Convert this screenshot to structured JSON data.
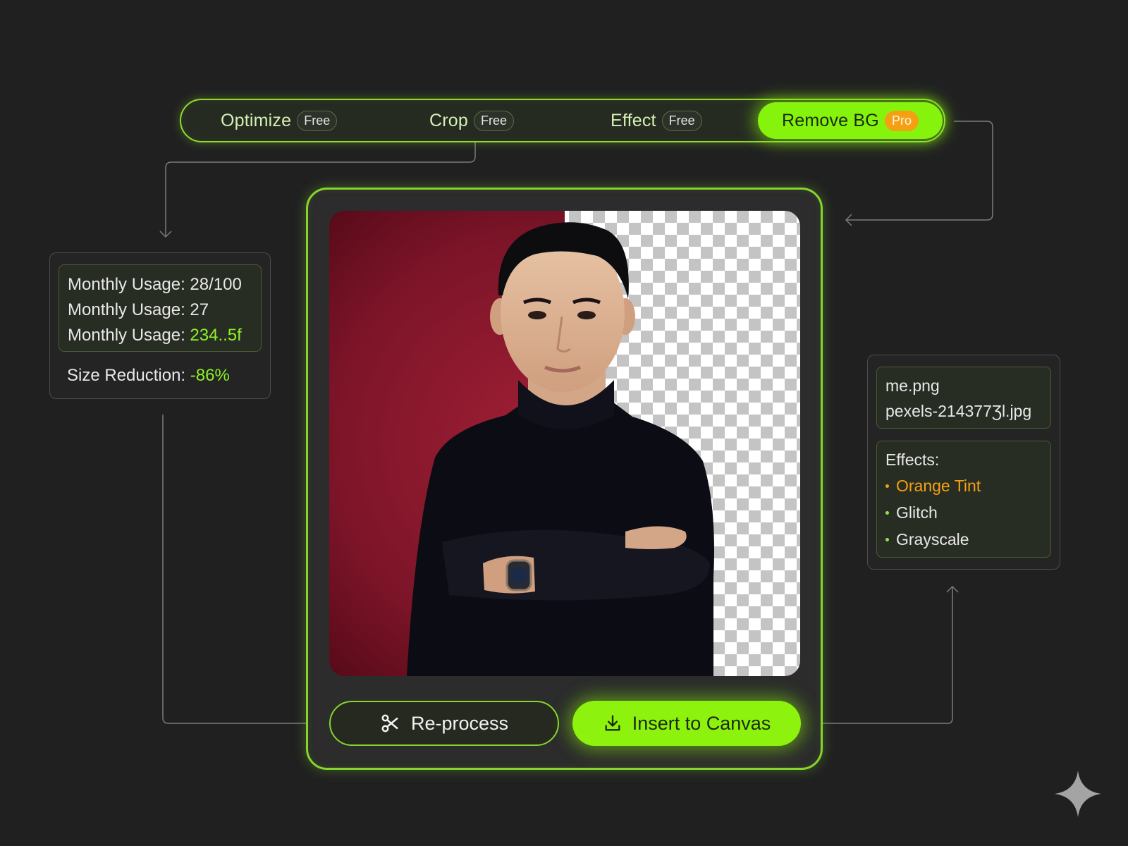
{
  "toolbar": {
    "tools": [
      {
        "label": "Optimize",
        "badge": "Free"
      },
      {
        "label": "Crop",
        "badge": "Free"
      },
      {
        "label": "Effect",
        "badge": "Free"
      },
      {
        "label": "Remove BG",
        "badge": "Pro",
        "active": true
      }
    ]
  },
  "stats": {
    "usage_label": "Monthly Usage:",
    "rows": [
      "28/100",
      "27",
      "234..5f"
    ],
    "size_label": "Size Reduction:",
    "size_value": "-86%"
  },
  "files": [
    "me.png",
    "pexels-214377Ʒl.jpg"
  ],
  "effects": {
    "title": "Effects:",
    "items": [
      "Orange Tint",
      "Glitch",
      "Grayscale"
    ]
  },
  "actions": {
    "reprocess": "Re-process",
    "insert": "Insert to Canvas"
  },
  "icons": {
    "reprocess": "scissors-icon",
    "insert": "download-icon",
    "corner": "sparkle-icon"
  },
  "colors": {
    "background": "#202021",
    "accent_green": "#8cf20e",
    "pro_orange": "#f5a012",
    "photo_red": "#7a1629"
  }
}
